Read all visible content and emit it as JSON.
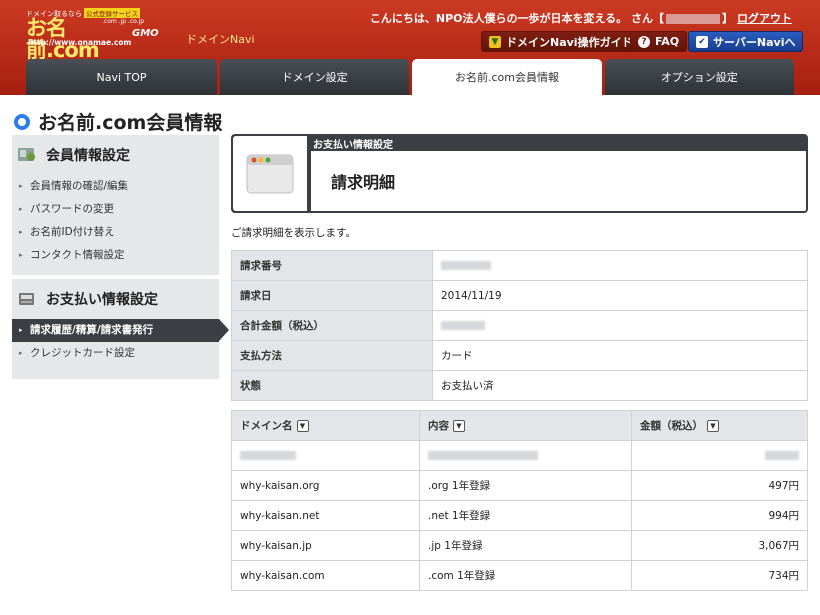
{
  "header": {
    "logo_tagline": "ドメイン取るなら",
    "logo_badge": "公式登録サービス",
    "logo_name": "お名前.com",
    "logo_tlds": ".com .jp .co.jp",
    "logo_url": "http://www.onamae.com",
    "gmo": "GMO",
    "navi_label": "ドメインNavi",
    "greeting_prefix": "こんにちは、NPO法人僕らの一歩が日本を変える。 さん",
    "bracket_open": "【",
    "bracket_close": "】",
    "logout_label": "ログアウト",
    "buttons": {
      "guide": "ドメインNavi操作ガイド",
      "faq": "FAQ",
      "server": "サーバーNaviへ"
    }
  },
  "tabs": [
    {
      "label": "Navi TOP"
    },
    {
      "label": "ドメイン設定"
    },
    {
      "label": "お名前.com会員情報"
    },
    {
      "label": "オプション設定"
    }
  ],
  "page_title": "お名前.com会員情報",
  "sidebar": {
    "member": {
      "heading": "会員情報設定",
      "items": [
        {
          "label": "会員情報の確認/編集"
        },
        {
          "label": "パスワードの変更"
        },
        {
          "label": "お名前ID付け替え"
        },
        {
          "label": "コンタクト情報設定"
        }
      ]
    },
    "payment": {
      "heading": "お支払い情報設定",
      "items": [
        {
          "label": "請求履歴/精算/請求書発行"
        },
        {
          "label": "クレジットカード設定"
        }
      ]
    }
  },
  "main": {
    "hero_subtitle": "お支払い情報設定",
    "hero_title": "請求明細",
    "intro": "ご請求明細を表示します。",
    "info": [
      {
        "label": "請求番号",
        "value": ""
      },
      {
        "label": "請求日",
        "value": "2014/11/19"
      },
      {
        "label": "合計金額（税込）",
        "value": ""
      },
      {
        "label": "支払方法",
        "value": "カード"
      },
      {
        "label": "状態",
        "value": "お支払い済"
      }
    ],
    "domain_table": {
      "headers": {
        "domain": "ドメイン名",
        "content": "内容",
        "amount": "金額（税込）"
      },
      "sort_icon": "▼",
      "rows": [
        {
          "domain": "",
          "content": "",
          "amount": ""
        },
        {
          "domain": "why-kaisan.org",
          "content": ".org 1年登録",
          "amount": "497円"
        },
        {
          "domain": "why-kaisan.net",
          "content": ".net 1年登録",
          "amount": "994円"
        },
        {
          "domain": "why-kaisan.jp",
          "content": ".jp 1年登録",
          "amount": "3,067円"
        },
        {
          "domain": "why-kaisan.com",
          "content": ".com 1年登録",
          "amount": "734円"
        }
      ]
    }
  },
  "colors": {
    "header_red": "#b8291c",
    "tab_dark": "#3b3f44",
    "accent_blue": "#2b7de9",
    "sidebar_bg": "#e6e7e9"
  }
}
